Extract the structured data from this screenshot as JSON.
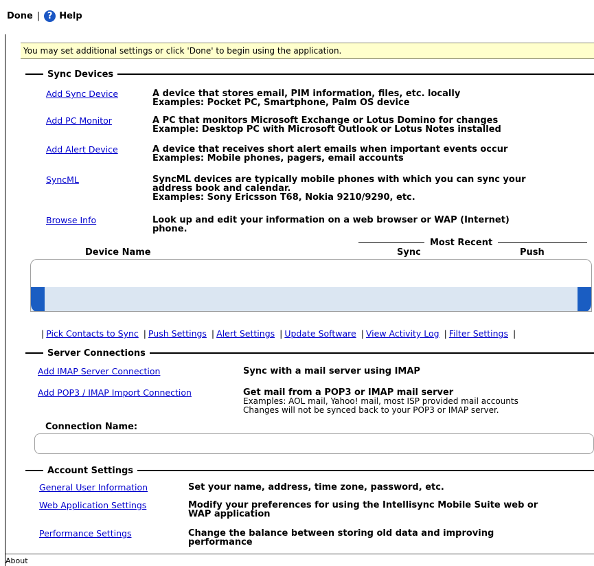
{
  "toolbar": {
    "done_label": "Done",
    "help_label": "Help"
  },
  "notice": "You may set additional settings or click 'Done' to begin using the application.",
  "sync_devices": {
    "title": "Sync Devices",
    "items": [
      {
        "link": "Add Sync Device",
        "desc": "A device that stores email, PIM information, files, etc. locally",
        "desc2": "Examples: Pocket PC, Smartphone, Palm OS device"
      },
      {
        "link": "Add PC Monitor",
        "desc": "A PC that monitors Microsoft Exchange or Lotus Domino for changes",
        "desc2": "Example: Desktop PC with Microsoft Outlook or Lotus Notes installed"
      },
      {
        "link": "Add Alert Device",
        "desc": "A device that receives short alert emails when important events occur",
        "desc2": "Examples: Mobile phones, pagers, email accounts"
      },
      {
        "link": "SyncML",
        "desc": "SyncML devices are typically mobile phones with which you can sync your",
        "desc2": "address book and calendar.",
        "desc3": "Examples: Sony Ericsson T68, Nokia 9210/9290, etc."
      },
      {
        "link": "Browse Info",
        "desc": "Look up and edit your information on a web browser or WAP (Internet)",
        "desc2": "phone."
      }
    ],
    "most_recent": "Most Recent",
    "columns": {
      "device_name": "Device Name",
      "sync": "Sync",
      "push": "Push"
    },
    "actions": [
      "Pick Contacts to Sync",
      "Push Settings",
      "Alert Settings",
      "Update Software",
      "View Activity Log",
      "Filter Settings"
    ]
  },
  "server_connections": {
    "title": "Server Connections",
    "items": [
      {
        "link": "Add IMAP Server Connection",
        "desc": "Sync with a mail server using IMAP"
      },
      {
        "link": "Add POP3 / IMAP Import Connection",
        "desc": "Get mail from a POP3 or IMAP mail server",
        "sub1": "Examples: AOL mail, Yahoo! mail, most ISP provided mail accounts",
        "sub2": "Changes will not be synced back to your POP3 or IMAP server."
      }
    ],
    "connection_name": "Connection Name:"
  },
  "account_settings": {
    "title": "Account Settings",
    "items": [
      {
        "link": "General User Information",
        "desc": "Set your name, address, time zone, password, etc."
      },
      {
        "link": "Web Application Settings",
        "desc": "Modify your preferences for using the Intellisync Mobile Suite web or",
        "desc2": "WAP application"
      },
      {
        "link": "Performance Settings",
        "desc": "Change the balance between storing old data and improving",
        "desc2": "performance"
      }
    ]
  },
  "footer": {
    "about": "About"
  },
  "colors": {
    "link": "#0000cc",
    "notice_bg": "#ffffcc",
    "accent": "#1a5dc2",
    "band": "#dbe6f2"
  }
}
